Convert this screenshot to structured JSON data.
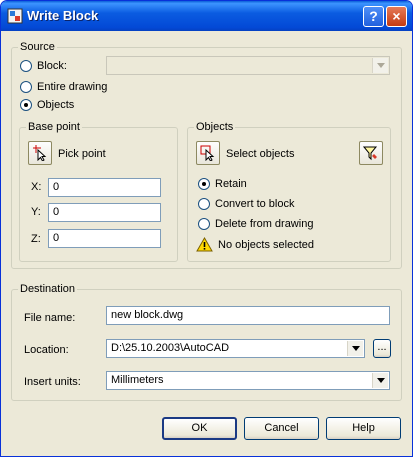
{
  "window": {
    "title": "Write Block"
  },
  "titlebar": {
    "help": "?",
    "close": "×"
  },
  "source": {
    "legend": "Source",
    "options": [
      {
        "label": "Block:",
        "selected": false
      },
      {
        "label": "Entire drawing",
        "selected": false
      },
      {
        "label": "Objects",
        "selected": true
      }
    ],
    "block_combo_value": ""
  },
  "base_point": {
    "legend": "Base point",
    "pick_point": "Pick point",
    "x_label": "X:",
    "x_value": "0",
    "y_label": "Y:",
    "y_value": "0",
    "z_label": "Z:",
    "z_value": "0"
  },
  "objects": {
    "legend": "Objects",
    "select_objects": "Select objects",
    "options": [
      {
        "label": "Retain",
        "selected": true
      },
      {
        "label": "Convert to block",
        "selected": false
      },
      {
        "label": "Delete from drawing",
        "selected": false
      }
    ],
    "status": "No objects selected"
  },
  "destination": {
    "legend": "Destination",
    "file_name_label": "File name:",
    "file_name_value": "new block.dwg",
    "location_label": "Location:",
    "location_value": "D:\\25.10.2003\\AutoCAD",
    "browse": "...",
    "units_label": "Insert units:",
    "units_value": "Millimeters"
  },
  "buttons": {
    "ok": "OK",
    "cancel": "Cancel",
    "help": "Help"
  }
}
